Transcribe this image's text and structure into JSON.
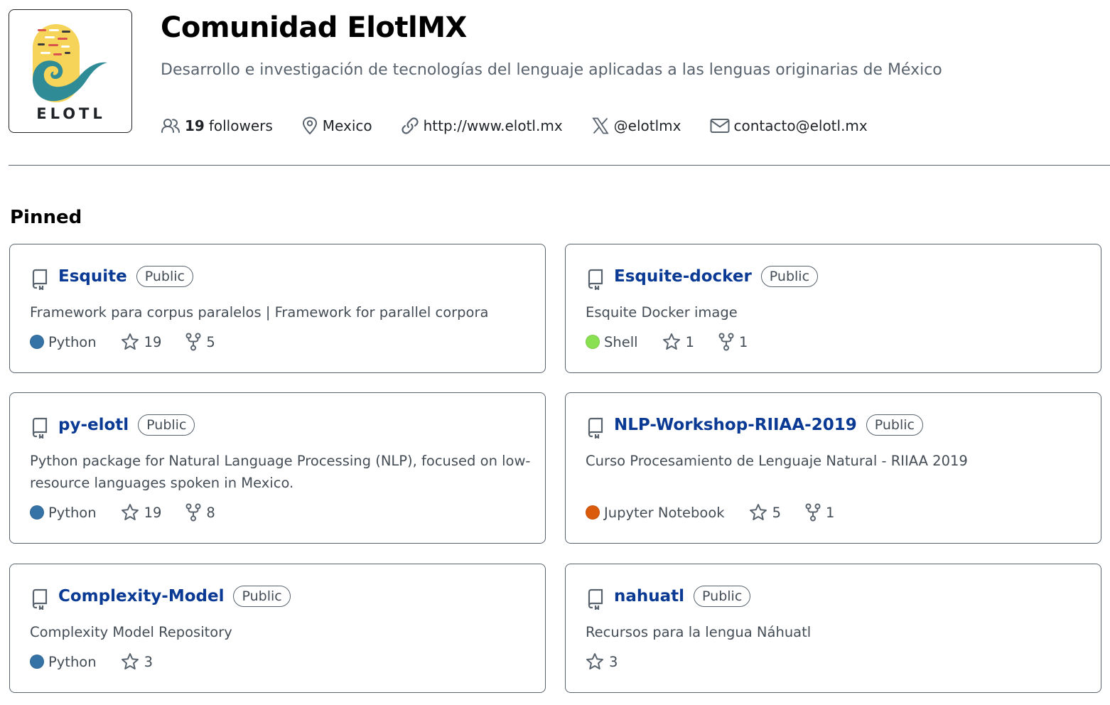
{
  "org": {
    "name": "Comunidad ElotlMX",
    "description": "Desarrollo e investigación de tecnologías del lenguaje aplicadas a las lenguas originarias de México",
    "logo_text": "ELOTL",
    "followers_count": "19",
    "followers_label": "followers",
    "location": "Mexico",
    "website": "http://www.elotl.mx",
    "twitter": "@elotlmx",
    "email": "contacto@elotl.mx"
  },
  "pinned": {
    "title": "Pinned",
    "repos": [
      {
        "name": "Esquite",
        "visibility": "Public",
        "description": "Framework para corpus paralelos | Framework for parallel corpora",
        "language": "Python",
        "language_color": "#3572A5",
        "stars": "19",
        "forks": "5"
      },
      {
        "name": "Esquite-docker",
        "visibility": "Public",
        "description": "Esquite Docker image",
        "language": "Shell",
        "language_color": "#89e051",
        "stars": "1",
        "forks": "1"
      },
      {
        "name": "py-elotl",
        "visibility": "Public",
        "description": "Python package for Natural Language Processing (NLP), focused on low-resource languages spoken in Mexico.",
        "language": "Python",
        "language_color": "#3572A5",
        "stars": "19",
        "forks": "8"
      },
      {
        "name": "NLP-Workshop-RIIAA-2019",
        "visibility": "Public",
        "description": "Curso Procesamiento de Lenguaje Natural - RIIAA 2019",
        "language": "Jupyter Notebook",
        "language_color": "#DA5B0B",
        "stars": "5",
        "forks": "1"
      },
      {
        "name": "Complexity-Model",
        "visibility": "Public",
        "description": "Complexity Model Repository",
        "language": "Python",
        "language_color": "#3572A5",
        "stars": "3",
        "forks": ""
      },
      {
        "name": "nahuatl",
        "visibility": "Public",
        "description": "Recursos para la lengua Náhuatl",
        "language": "",
        "language_color": "",
        "stars": "3",
        "forks": ""
      }
    ]
  },
  "icons": {
    "people": "people-icon",
    "location": "location-icon",
    "link": "link-icon",
    "x": "x-logo-icon",
    "mail": "mail-icon",
    "repo": "repo-icon",
    "star": "star-icon",
    "fork": "fork-icon"
  }
}
